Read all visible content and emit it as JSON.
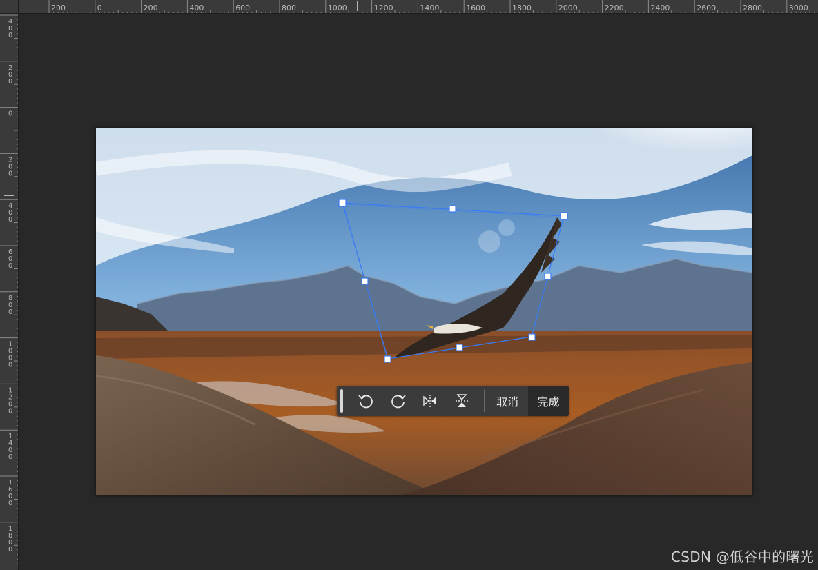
{
  "rulers": {
    "horizontal_labels": [
      "200",
      "0",
      "200",
      "400",
      "600",
      "800",
      "1000",
      "1200",
      "1400",
      "1600",
      "1800",
      "2000",
      "2200",
      "2400",
      "2600",
      "2800",
      "3000"
    ],
    "vertical_labels": [
      "400",
      "200",
      "0",
      "200",
      "400",
      "600",
      "800",
      "1000",
      "1200",
      "1400",
      "1600",
      "1800"
    ]
  },
  "toolbar": {
    "rotate_left_icon": "rotate-counterclockwise",
    "rotate_right_icon": "rotate-clockwise",
    "flip_horizontal_icon": "flip-horizontal",
    "flip_vertical_icon": "flip-vertical",
    "cancel_label": "取消",
    "done_label": "完成"
  },
  "transform_box": {
    "color": "#3a7bf5",
    "handle_fill": "#ffffff"
  },
  "watermark": "CSDN @低谷中的曙光",
  "colors": {
    "background": "#282828",
    "ruler": "#3a3a3a",
    "toolbar": "#3b3b3b",
    "done_button": "#2a2a2a"
  }
}
